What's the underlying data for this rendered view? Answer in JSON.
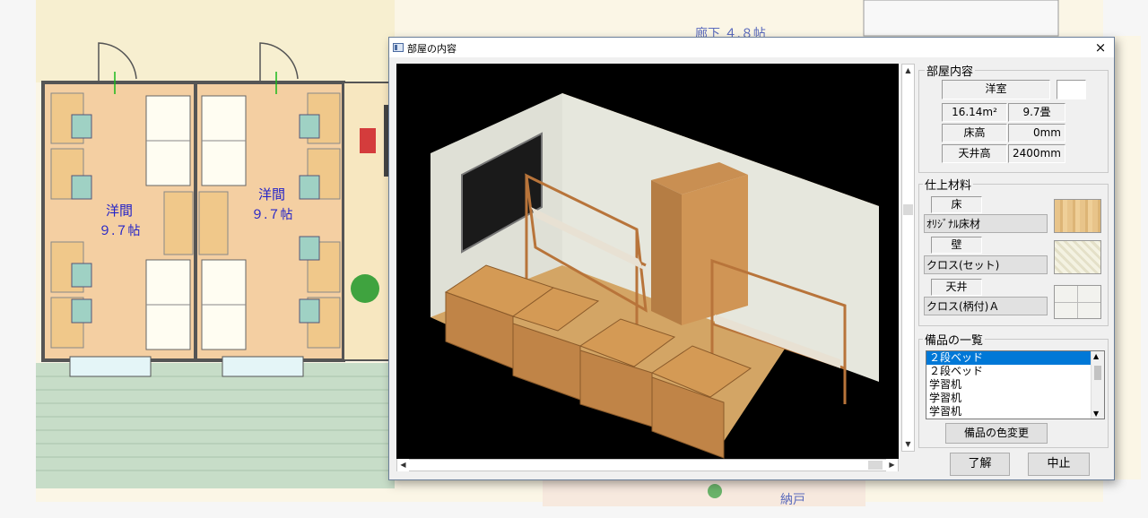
{
  "background": {
    "room_left": {
      "label": "洋間",
      "size": "９.７帖"
    },
    "room_right": {
      "label": "洋間",
      "size": "９.７帖"
    },
    "corridor_label": "廊下 ４.８帖",
    "closet_label": "納戸"
  },
  "dialog": {
    "title": "部屋の内容",
    "close_glyph": "×",
    "room_info": {
      "group_title": "部屋内容",
      "room_type": "洋室",
      "area_m2": "16.14m²",
      "area_tatami": "9.7畳",
      "floor_height_label": "床高",
      "floor_height": "0mm",
      "ceiling_height_label": "天井高",
      "ceiling_height": "2400mm"
    },
    "finish": {
      "group_title": "仕上材料",
      "floor_label": "床",
      "floor_material": "ｵﾘｼﾞﾅﾙ床材",
      "wall_label": "壁",
      "wall_material": "クロス(セット)",
      "ceiling_label": "天井",
      "ceiling_material": "クロス(柄付)Ａ"
    },
    "equipment": {
      "group_title": "備品の一覧",
      "items": [
        "２段ベッド",
        "２段ベッド",
        "学習机",
        "学習机",
        "学習机"
      ],
      "selected_index": 0,
      "color_change_label": "備品の色変更"
    },
    "ok_label": "了解",
    "cancel_label": "中止"
  },
  "colors": {
    "selection": "#0078d7",
    "room_fill": "#f4cfa2",
    "wood": "#d49a55"
  }
}
